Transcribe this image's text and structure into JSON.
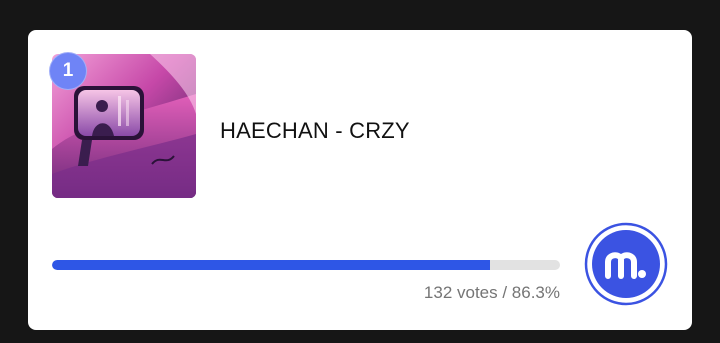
{
  "entry": {
    "rank": "1",
    "title": "HAECHAN - CRZY",
    "votes": 132,
    "percent": 86.3,
    "stats_text": "132 votes / 86.3%"
  },
  "colors": {
    "background": "#161616",
    "card": "#ffffff",
    "badge": "#6f84f6",
    "progress_fill": "#2e56e6",
    "progress_track": "#e2e2e2",
    "vote_button": "#3b53e2"
  },
  "icons": {
    "album_cover": "album-cover-art",
    "vote_button": "m-logo-icon"
  }
}
